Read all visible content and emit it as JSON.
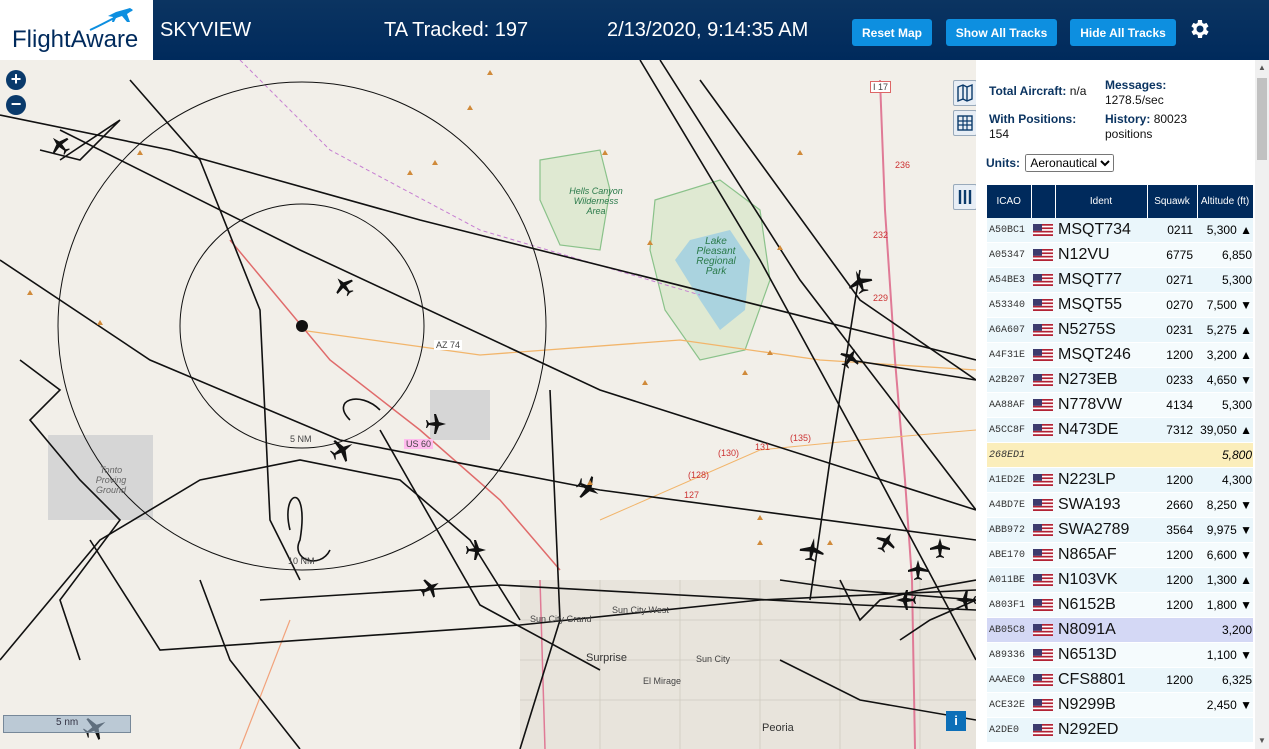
{
  "header": {
    "logo_text": "FlightAware",
    "app_title": "SKYVIEW",
    "ta_tracked": "TA Tracked: 197",
    "datetime": "2/13/2020, 9:14:35 AM",
    "reset_map_label": "Reset Map",
    "show_all_tracks_label": "Show All Tracks",
    "hide_all_tracks_label": "Hide All Tracks"
  },
  "map": {
    "zoom_in": "+",
    "zoom_out": "−",
    "scale_label": "5 nm",
    "info_label": "i",
    "labels": {
      "az74": "AZ 74",
      "us60": "US 60",
      "range_5nm": "5 NM",
      "range_10nm": "10 NM",
      "hells_canyon": "Hells Canyon Wilderness Area",
      "lake_pleasant": "Lake Pleasant Regional Park",
      "proving_ground": "Tonto Proving Ground",
      "sun_city_grand": "Sun City Grand",
      "sun_city": "Sun City",
      "sun_city_west": "Sun City West",
      "surprise": "Surprise",
      "el_mirage": "El Mirage",
      "peoria": "Peoria",
      "i17": "I 17",
      "r229": "229",
      "r232": "232",
      "r236": "236",
      "r131": "131",
      "r135": "(135)",
      "r128": "(128)",
      "r130": "(130)",
      "r127": "127"
    }
  },
  "stats": {
    "total_aircraft_label": "Total Aircraft:",
    "total_aircraft_value": "n/a",
    "messages_label": "Messages:",
    "messages_value": "1278.5/sec",
    "with_positions_label": "With Positions:",
    "with_positions_value": "154",
    "history_label": "History:",
    "history_value": "80023 positions"
  },
  "units": {
    "label": "Units:",
    "selected": "Aeronautical"
  },
  "table": {
    "headers": [
      "ICAO",
      "",
      "Ident",
      "Squawk",
      "Altitude (ft)"
    ],
    "rows": [
      {
        "icao": "A50BC1",
        "ident": "MSQT734",
        "squawk": "0211",
        "alt": "5,300 ▲"
      },
      {
        "icao": "A05347",
        "ident": "N12VU",
        "squawk": "6775",
        "alt": "6,850"
      },
      {
        "icao": "A54BE3",
        "ident": "MSQT77",
        "squawk": "0271",
        "alt": "5,300"
      },
      {
        "icao": "A53340",
        "ident": "MSQT55",
        "squawk": "0270",
        "alt": "7,500 ▼"
      },
      {
        "icao": "A6A607",
        "ident": "N5275S",
        "squawk": "0231",
        "alt": "5,275 ▲"
      },
      {
        "icao": "A4F31E",
        "ident": "MSQT246",
        "squawk": "1200",
        "alt": "3,200 ▲"
      },
      {
        "icao": "A2B207",
        "ident": "N273EB",
        "squawk": "0233",
        "alt": "4,650 ▼"
      },
      {
        "icao": "AA88AF",
        "ident": "N778VW",
        "squawk": "4134",
        "alt": "5,300"
      },
      {
        "icao": "A5CC8F",
        "ident": "N473DE",
        "squawk": "7312",
        "alt": "39,050 ▲"
      },
      {
        "icao": "268ED1",
        "ident": "",
        "squawk": "",
        "alt": "5,800"
      },
      {
        "icao": "A1ED2E",
        "ident": "N223LP",
        "squawk": "1200",
        "alt": "4,300"
      },
      {
        "icao": "A4BD7E",
        "ident": "SWA193",
        "squawk": "2660",
        "alt": "8,250 ▼"
      },
      {
        "icao": "ABB972",
        "ident": "SWA2789",
        "squawk": "3564",
        "alt": "9,975 ▼"
      },
      {
        "icao": "ABE170",
        "ident": "N865AF",
        "squawk": "1200",
        "alt": "6,600 ▼"
      },
      {
        "icao": "A011BE",
        "ident": "N103VK",
        "squawk": "1200",
        "alt": "1,300 ▲"
      },
      {
        "icao": "A803F1",
        "ident": "N6152B",
        "squawk": "1200",
        "alt": "1,800 ▼"
      },
      {
        "icao": "AB05C8",
        "ident": "N8091A",
        "squawk": "",
        "alt": "3,200"
      },
      {
        "icao": "A89336",
        "ident": "N6513D",
        "squawk": "",
        "alt": "1,100 ▼"
      },
      {
        "icao": "AAAEC0",
        "ident": "CFS8801",
        "squawk": "1200",
        "alt": "6,325"
      },
      {
        "icao": "ACE32E",
        "ident": "N9299B",
        "squawk": "",
        "alt": "2,450 ▼"
      },
      {
        "icao": "A2DE0",
        "ident": "N292ED",
        "squawk": "",
        "alt": ""
      }
    ]
  },
  "colors": {
    "header_bg": "#002a5c",
    "button_bg": "#0d8fe0",
    "row_bg": "#eaf6fb",
    "highlight_row": "#fbeebb",
    "selected_row": "#d4d8f5"
  },
  "icons": [
    "flightaware-plane-icon",
    "gear-icon",
    "map-layers-icon",
    "grid-icon",
    "columns-icon",
    "zoom-in-icon",
    "zoom-out-icon",
    "info-icon",
    "us-flag-icon",
    "aircraft-icon"
  ]
}
